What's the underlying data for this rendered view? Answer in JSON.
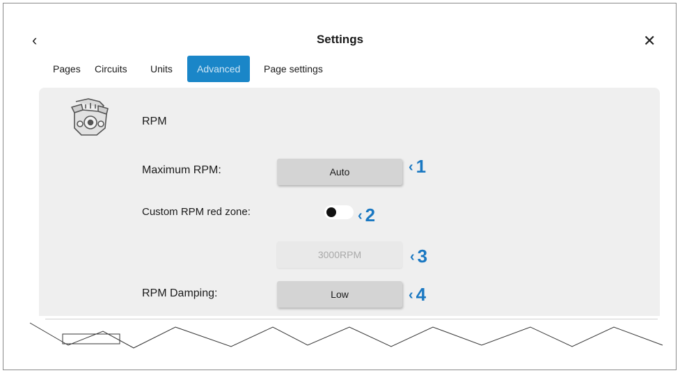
{
  "header": {
    "title": "Settings",
    "back_icon": "‹",
    "close_icon": "✕"
  },
  "tabs": [
    {
      "label": "Pages",
      "active": false
    },
    {
      "label": "Circuits",
      "active": false
    },
    {
      "label": "Units",
      "active": false
    },
    {
      "label": "Advanced",
      "active": true
    },
    {
      "label": "Page settings",
      "active": false
    }
  ],
  "section": {
    "icon": "engine-icon",
    "title": "RPM"
  },
  "rows": {
    "max_rpm": {
      "label": "Maximum RPM:",
      "value": "Auto"
    },
    "red_zone": {
      "label": "Custom RPM red zone:",
      "toggle_on": false
    },
    "red_zone_value": {
      "value": "3000RPM",
      "enabled": false
    },
    "damping": {
      "label": "RPM Damping:",
      "value": "Low"
    }
  },
  "callouts": [
    "1",
    "2",
    "3",
    "4"
  ],
  "colors": {
    "accent": "#1a86c8",
    "callout": "#1a78c2",
    "panel": "#efefef"
  }
}
